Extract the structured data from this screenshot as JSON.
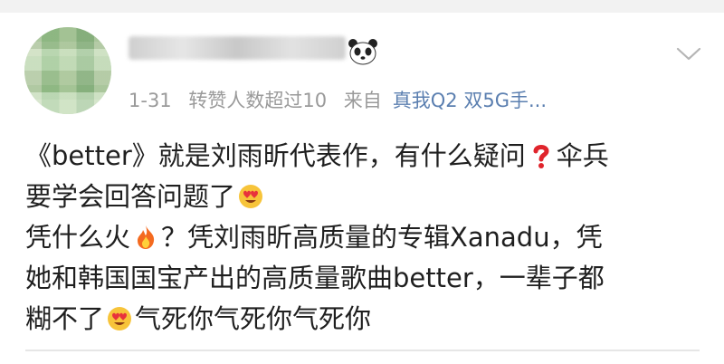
{
  "post": {
    "meta": {
      "date": "1-31",
      "reposts": "转赞人数超过10",
      "from_label": "来自",
      "source": "真我Q2 双5G手..."
    },
    "content_lines": [
      "《better》就是刘雨昕代表作，有什么疑问",
      "伞兵",
      "要学会回答问题了",
      "凭什么火",
      "？凭刘雨昕高质量的专辑Xanadu，凭",
      "她和韩国国宝产出的高质量歌曲better，一辈子都",
      "糊不了",
      "气死你气死你气死你"
    ]
  },
  "icons": {
    "panda": "panda-icon",
    "chevron": "chevron-down-icon",
    "emoji_question": "red-question-icon",
    "emoji_heart_eyes": "heart-eyes-icon",
    "emoji_fire": "fire-icon"
  },
  "colors": {
    "meta_gray": "#9a9a9a",
    "source_blue": "#5b7fb0",
    "text": "#1f1f1f"
  }
}
